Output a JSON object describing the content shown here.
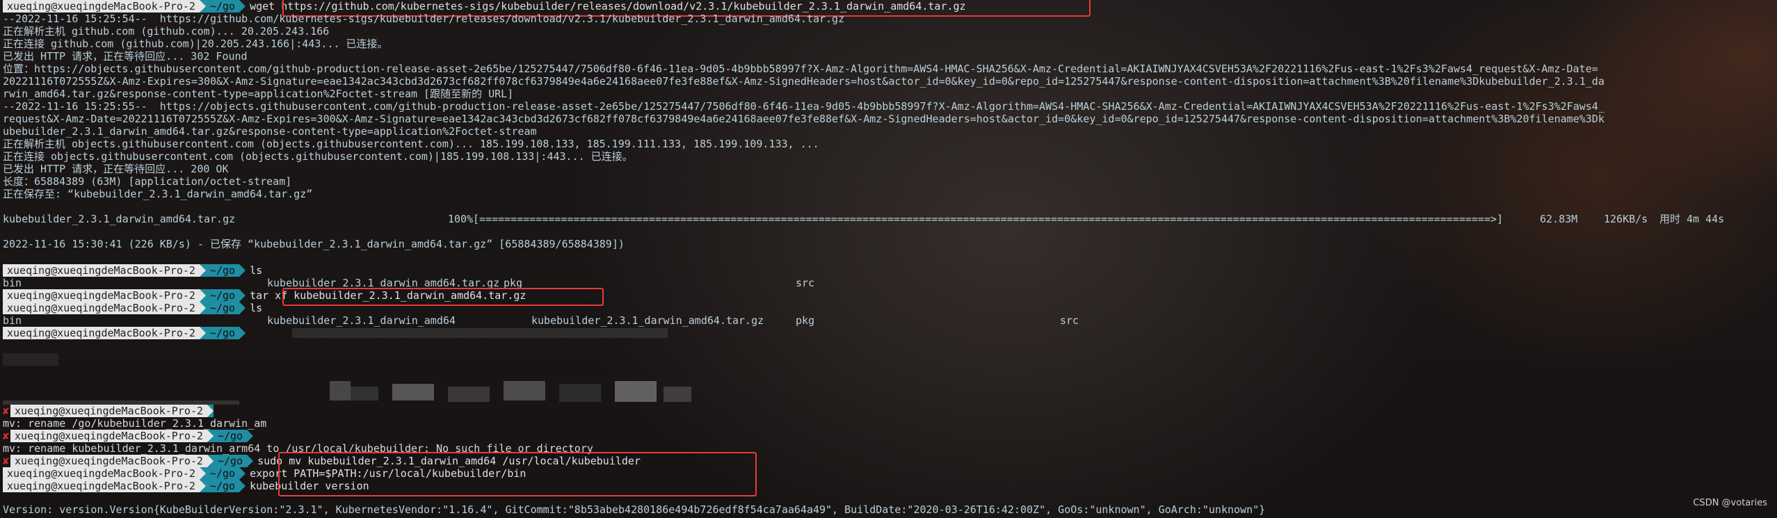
{
  "prompt": {
    "user": "xueqing@xueqingdeMacBook-Pro-2",
    "dir": "~/go"
  },
  "wget_cmd": "wget https://github.com/kubernetes-sigs/kubebuilder/releases/download/v2.3.1/kubebuilder_2.3.1_darwin_amd64.tar.gz",
  "wget_output": [
    "--2022-11-16 15:25:54--  https://github.com/kubernetes-sigs/kubebuilder/releases/download/v2.3.1/kubebuilder_2.3.1_darwin_amd64.tar.gz",
    "正在解析主机 github.com (github.com)... 20.205.243.166",
    "正在连接 github.com (github.com)|20.205.243.166|:443... 已连接。",
    "已发出 HTTP 请求，正在等待回应... 302 Found",
    "位置：https://objects.githubusercontent.com/github-production-release-asset-2e65be/125275447/7506df80-6f46-11ea-9d05-4b9bbb58997f?X-Amz-Algorithm=AWS4-HMAC-SHA256&X-Amz-Credential=AKIAIWNJYAX4CSVEH53A%2F20221116%2Fus-east-1%2Fs3%2Faws4_request&X-Amz-Date=",
    "20221116T072555Z&X-Amz-Expires=300&X-Amz-Signature=eae1342ac343cbd3d2673cf682ff078cf6379849e4a6e24168aee07fe3fe88ef&X-Amz-SignedHeaders=host&actor_id=0&key_id=0&repo_id=125275447&response-content-disposition=attachment%3B%20filename%3Dkubebuilder_2.3.1_da",
    "rwin_amd64.tar.gz&response-content-type=application%2Foctet-stream [跟随至新的 URL]",
    "--2022-11-16 15:25:55--  https://objects.githubusercontent.com/github-production-release-asset-2e65be/125275447/7506df80-6f46-11ea-9d05-4b9bbb58997f?X-Amz-Algorithm=AWS4-HMAC-SHA256&X-Amz-Credential=AKIAIWNJYAX4CSVEH53A%2F20221116%2Fus-east-1%2Fs3%2Faws4_",
    "request&X-Amz-Date=20221116T072555Z&X-Amz-Expires=300&X-Amz-Signature=eae1342ac343cbd3d2673cf682ff078cf6379849e4a6e24168aee07fe3fe88ef&X-Amz-SignedHeaders=host&actor_id=0&key_id=0&repo_id=125275447&response-content-disposition=attachment%3B%20filename%3Dk",
    "ubebuilder_2.3.1_darwin_amd64.tar.gz&response-content-type=application%2Foctet-stream",
    "正在解析主机 objects.githubusercontent.com (objects.githubusercontent.com)... 185.199.108.133, 185.199.111.133, 185.199.109.133, ...",
    "正在连接 objects.githubusercontent.com (objects.githubusercontent.com)|185.199.108.133|:443... 已连接。",
    "已发出 HTTP 请求，正在等待回应... 200 OK",
    "长度：65884389 (63M) [application/octet-stream]",
    "正在保存至: “kubebuilder_2.3.1_darwin_amd64.tar.gz”"
  ],
  "progress": {
    "filename": "kubebuilder_2.3.1_darwin_amd64.tar.gz",
    "percent": "100%",
    "bar": "[=================================================================================================================================================================>]",
    "size": "62.83M",
    "speed": "126KB/s",
    "time": "用时 4m 44s",
    "fraction": 1.0
  },
  "saved_line": "2022-11-16 15:30:41 (226 KB/s) - 已保存 “kubebuilder_2.3.1_darwin_amd64.tar.gz” [65884389/65884389])",
  "ls1_cmd": "ls",
  "ls1_items": [
    "bin",
    "kubebuilder_2.3.1_darwin_amd64.tar.gz",
    "pkg",
    "src"
  ],
  "tar_cmd": "tar xf kubebuilder_2.3.1_darwin_amd64.tar.gz",
  "ls2_cmd": "ls",
  "ls2_items": [
    "bin",
    "kubebuilder_2.3.1_darwin_amd64",
    "kubebuilder_2.3.1_darwin_amd64.tar.gz",
    "pkg",
    "src"
  ],
  "mv_err1": "mv: rename /go/kubebuilder_2.3.1_darwin_am",
  "mv_err2": "mv: rename kubebuilder_2.3.1_darwin_arm64 to /usr/local/kubebuilder: No such file or directory",
  "sudo_cmd": "sudo mv kubebuilder_2.3.1_darwin_amd64 /usr/local/kubebuilder",
  "export_cmd": "export PATH=$PATH:/usr/local/kubebuilder/bin",
  "version_cmd": "kubebuilder version",
  "version_output": "Version: version.Version{KubeBuilderVersion:\"2.3.1\", KubernetesVendor:\"1.16.4\", GitCommit:\"8b53abeb4280186e494b726edf8f54ca7aa64a49\", BuildDate:\"2020-03-26T16:42:00Z\", GoOs:\"unknown\", GoArch:\"unknown\"}",
  "watermark": "CSDN @votaries"
}
